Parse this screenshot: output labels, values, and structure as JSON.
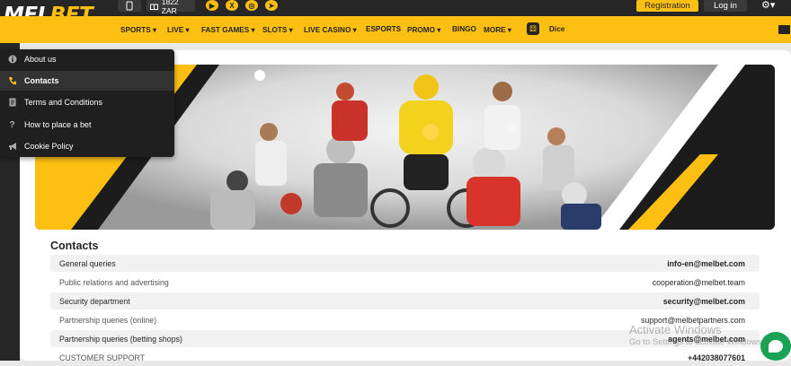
{
  "header": {
    "logo_main": "MEL",
    "logo_accent": "BET",
    "balance": "1822 ZAR",
    "registration_label": "Registration",
    "login_label": "Log in",
    "social_icons": [
      "youtube-icon",
      "x-icon",
      "instagram-icon",
      "telegram-icon"
    ]
  },
  "nav": {
    "items": [
      "SPORTS",
      "LIVE",
      "FAST GAMES",
      "SLOTS",
      "LIVE CASINO",
      "ESPORTS",
      "PROMO",
      "BINGO",
      "MORE",
      "Dice"
    ]
  },
  "dropdown": {
    "items": [
      {
        "label": "About us",
        "icon": "info-icon"
      },
      {
        "label": "Contacts",
        "icon": "phone-icon"
      },
      {
        "label": "Terms and Conditions",
        "icon": "document-icon"
      },
      {
        "label": "How to place a bet",
        "icon": "question-icon"
      },
      {
        "label": "Cookie Policy",
        "icon": "megaphone-icon"
      }
    ]
  },
  "contacts": {
    "title": "Contacts",
    "rows": [
      {
        "label": "General queries",
        "value": "info-en@melbet.com"
      },
      {
        "label": "Public relations and advertising",
        "value": "cooperation@melbet.team"
      },
      {
        "label": "Security department",
        "value": "security@melbet.com"
      },
      {
        "label": "Partnership queries (online)",
        "value": "support@melbetpartners.com"
      },
      {
        "label": "Partnership queries (betting shops)",
        "value": "agents@melbet.com"
      },
      {
        "label": "CUSTOMER SUPPORT",
        "value": "+442038077601"
      }
    ]
  },
  "watermark": {
    "line1": "Activate Windows",
    "line2": "Go to Settings to activate Windows."
  },
  "colors": {
    "brand_yellow": "#fdbf12",
    "dark": "#262626",
    "chat_green": "#1aa255"
  }
}
